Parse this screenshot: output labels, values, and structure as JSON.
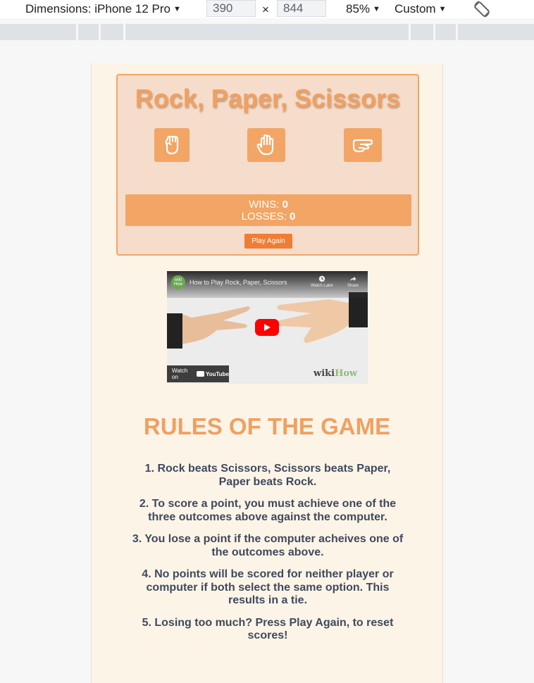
{
  "devtools": {
    "dimensions_label": "Dimensions: iPhone 12 Pro",
    "width_value": "390",
    "times_sign": "×",
    "height_value": "844",
    "zoom": "85%",
    "throttle": "Custom"
  },
  "game": {
    "title": "Rock, Paper, Scissors",
    "choices": [
      "rock",
      "paper",
      "scissors"
    ],
    "wins_label": "WINS:",
    "wins_value": "0",
    "losses_label": "LOSSES:",
    "losses_value": "0",
    "play_again_label": "Play Again"
  },
  "video": {
    "channel_short": "wiki How",
    "title": "How to Play Rock, Paper, Scissors",
    "watch_later": "Watch Later",
    "share": "Share",
    "watch_on": "Watch on",
    "youtube": "YouTube",
    "brand_wiki": "wiki",
    "brand_how": "How"
  },
  "rules": {
    "title": "RULES OF THE GAME",
    "items": [
      "1. Rock beats Scissors, Scissors beats Paper, Paper beats Rock.",
      "2. To score a point, you must achieve one of the three outcomes above against the computer.",
      "3. You lose a point if the computer acheives one of the outcomes above.",
      "4. No points will be scored for neither player or computer if both select the same option. This results in a tie.",
      "5. Losing too much? Press Play Again, to reset scores!"
    ]
  },
  "colors": {
    "accent": "#f2a564",
    "title": "#f0a060",
    "page_bg": "#fdf4e8",
    "card_bg": "#f5dccb",
    "button": "#ef7d35",
    "rules_text": "#3e4a5c"
  }
}
